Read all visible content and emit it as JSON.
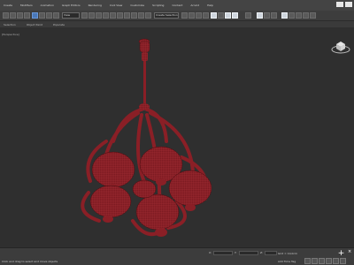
{
  "menubar": {
    "items": [
      "Create",
      "Modifiers",
      "Animation",
      "Graph Editors",
      "Rendering",
      "Civil View",
      "Customize",
      "Scripting",
      "Content",
      "Arnold",
      "Help"
    ]
  },
  "toolbar": {
    "view_dropdown": "View",
    "selection_set_dropdown": "Create Selection Se"
  },
  "ribbon": {
    "tabs": [
      "Selection",
      "Object Paint",
      "Populate"
    ]
  },
  "viewport": {
    "label": "[Perspective]"
  },
  "status": {
    "x_label": "X:",
    "y_label": "Y:",
    "z_label": "Z:",
    "grid_text": "Grid = 10,0cm",
    "add_time_tag": "Add Time Tag",
    "prompt": "Click and drag to select and move objects"
  },
  "colors": {
    "object": "#8a1f26",
    "object_highlight": "#b8393f",
    "viewport_bg": "#2f2f2f",
    "accent": "#4a78b8"
  }
}
